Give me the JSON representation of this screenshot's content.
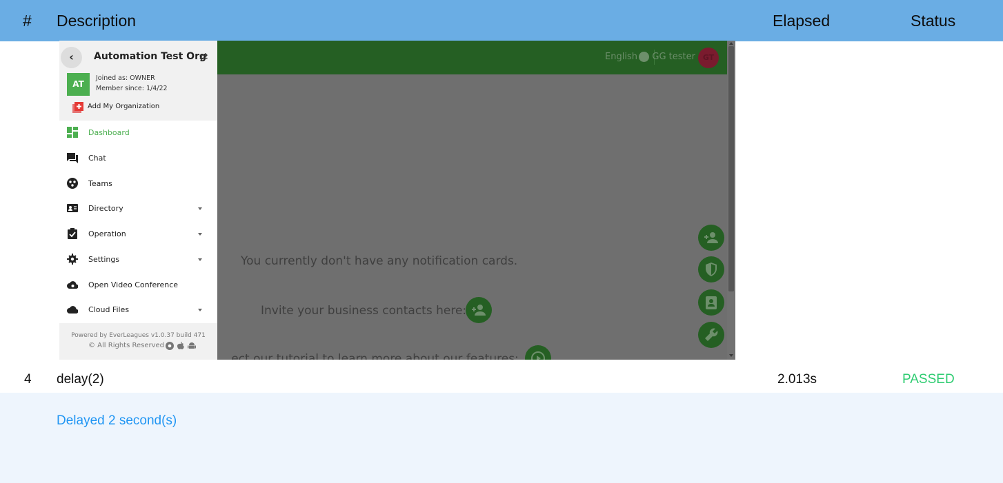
{
  "report": {
    "columns": {
      "num": "#",
      "description": "Description",
      "elapsed": "Elapsed",
      "status": "Status"
    },
    "row": {
      "num": "4",
      "description": "delay(2)",
      "elapsed": "2.013s",
      "status": "PASSED",
      "detail": "Delayed 2 second(s)"
    }
  },
  "app": {
    "topbar": {
      "language": "English",
      "username": "GG tester",
      "avatar_initials": "GT"
    },
    "sidebar": {
      "org_name": "Automation Test Org",
      "org_initials": "AT",
      "joined_as": "Joined as: OWNER",
      "member_since": "Member since: 1/4/22",
      "add_org": "Add My Organization",
      "items": [
        {
          "label": "Dashboard",
          "icon": "dashboard-icon",
          "active": true,
          "expandable": false
        },
        {
          "label": "Chat",
          "icon": "chat-icon",
          "active": false,
          "expandable": false
        },
        {
          "label": "Teams",
          "icon": "teams-icon",
          "active": false,
          "expandable": false
        },
        {
          "label": "Directory",
          "icon": "contact-card-icon",
          "active": false,
          "expandable": true
        },
        {
          "label": "Operation",
          "icon": "clipboard-check-icon",
          "active": false,
          "expandable": true
        },
        {
          "label": "Settings",
          "icon": "gear-icon",
          "active": false,
          "expandable": true
        },
        {
          "label": "Open Video Conference",
          "icon": "video-cloud-icon",
          "active": false,
          "expandable": false
        },
        {
          "label": "Cloud Files",
          "icon": "cloud-icon",
          "active": false,
          "expandable": true
        }
      ],
      "footer_powered": "Powered by EverLeagues v1.0.37 build 471",
      "footer_rights": "© All Rights Reserved"
    },
    "main": {
      "empty_message": "You currently don't have any notification cards.",
      "invite_message": "Invite your business contacts here:",
      "tutorial_message": "...ect our tutorial to learn more about our features:"
    },
    "colors": {
      "accent": "#4caf50",
      "topbar": "#255f23",
      "status_passed": "#2ecc71",
      "detail_text": "#2196f3",
      "header_bg": "#6aade4"
    }
  }
}
